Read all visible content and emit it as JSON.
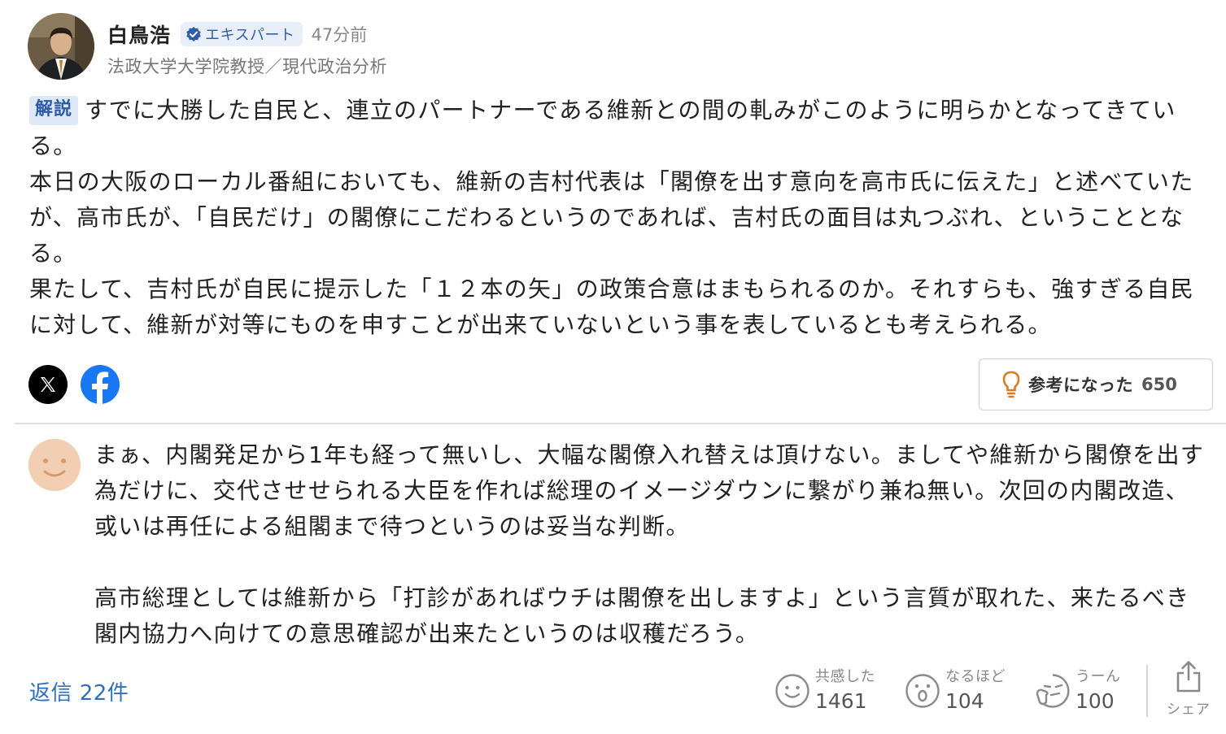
{
  "expert": {
    "name": "白鳥浩",
    "badge": "エキスパート",
    "time": "47分前",
    "title": "法政大学大学院教授／現代政治分析"
  },
  "commentary": {
    "tag": "解説",
    "paragraphs": [
      "すでに大勝した自民と、連立のパートナーである維新との間の軋みがこのように明らかとなってきている。",
      "本日の大阪のローカル番組においても、維新の吉村代表は「閣僚を出す意向を高市氏に伝えた」と述べていたが、高市氏が、「自民だけ」の閣僚にこだわるというのであれば、吉村氏の面目は丸つぶれ、ということとなる。",
      "果たして、吉村氏が自民に提示した「１２本の矢」の政策合意はまもられるのか。それすらも、強すぎる自民に対して、維新が対等にものを申すことが出来ていないという事を表しているとも考えられる。"
    ]
  },
  "share_icons": [
    "x-icon",
    "facebook-icon"
  ],
  "helpful": {
    "label": "参考になった",
    "count": "650"
  },
  "comment": {
    "paragraphs": [
      "まぁ、内閣発足から1年も経って無いし、大幅な閣僚入れ替えは頂けない。ましてや維新から閣僚を出す為だけに、交代させせられる大臣を作れば総理のイメージダウンに繋がり兼ね無い。次回の内閣改造、或いは再任による組閣まで待つというのは妥当な判断。",
      "高市総理としては維新から「打診があればウチは閣僚を出しますよ」という言質が取れた、来たるべき閣内協力へ向けての意思確認が出来たというのは収穫だろう。"
    ],
    "replies": "返信 22件",
    "reactions": [
      {
        "label": "共感した",
        "count": "1461",
        "icon": "smile-icon"
      },
      {
        "label": "なるほど",
        "count": "104",
        "icon": "surprised-icon"
      },
      {
        "label": "うーん",
        "count": "100",
        "icon": "thinking-icon"
      }
    ],
    "share_label": "シェア"
  },
  "colors": {
    "link": "#2f6fc0",
    "badge_bg": "#e8eff8",
    "tag_bg": "#dfe8f6",
    "helpful_bulb": "#e07b1f",
    "facebook": "#1877f2"
  }
}
